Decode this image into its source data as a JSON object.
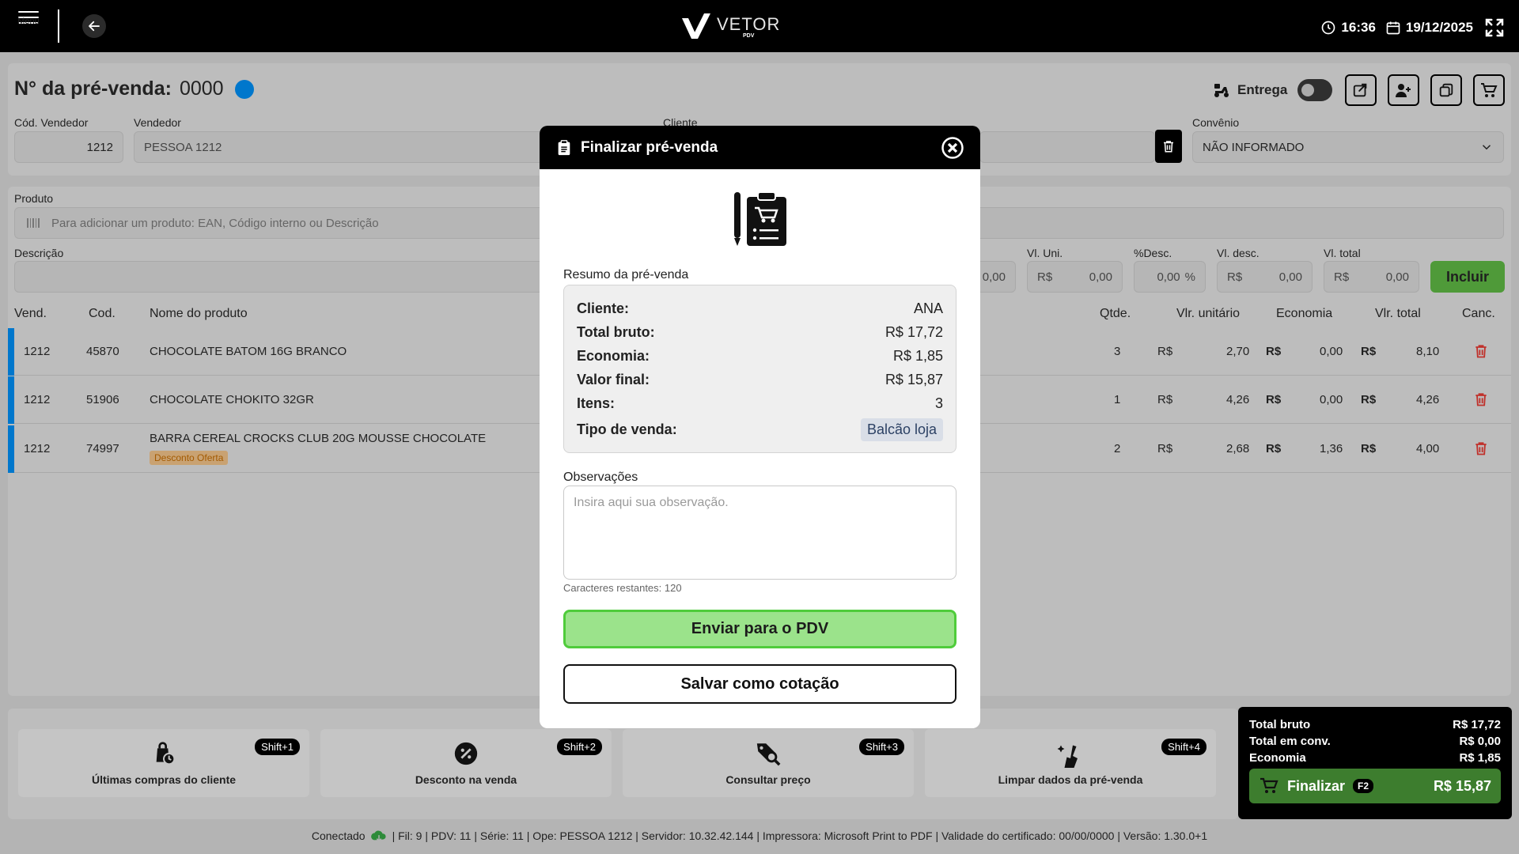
{
  "topbar": {
    "menu_label": "Menu",
    "logo_main": "VETOR",
    "logo_sub": "PDV",
    "time": "16:36",
    "date": "19/12/2025"
  },
  "header": {
    "title_prefix": "N° da pré-venda:",
    "number": "0000",
    "entrega_label": "Entrega",
    "labels": {
      "cod_vendedor": "Cód. Vendedor",
      "vendedor": "Vendedor",
      "cliente": "Cliente",
      "convenio": "Convênio"
    },
    "cod_vendedor_value": "1212",
    "vendedor_value": "PESSOA 1212",
    "convenio_value": "NÃO INFORMADO"
  },
  "product": {
    "label": "Produto",
    "placeholder": "Para adicionar um produto: EAN, Código interno ou Descrição",
    "desc_label": "Descrição",
    "qty_value": "0,00",
    "vl_uni_label": "Vl. Uni.",
    "desc_pct_label": "%Desc.",
    "vl_desc_label": "Vl. desc.",
    "vl_total_label": "Vl. total",
    "currency": "R$",
    "zero": "0,00",
    "pct": "%",
    "add_label": "Incluir"
  },
  "table": {
    "headers": {
      "vend": "Vend.",
      "cod": "Cod.",
      "nome": "Nome do produto",
      "qtde": "Qtde.",
      "unit": "Vlr. unitário",
      "economia": "Economia",
      "total": "Vlr. total",
      "canc": "Canc."
    },
    "rows": [
      {
        "vend": "1212",
        "cod": "45870",
        "nome": "CHOCOLATE BATOM 16G BRANCO",
        "badge": "",
        "qtde": "3",
        "cur": "R$",
        "unit": "2,70",
        "eco": "0,00",
        "total": "8,10"
      },
      {
        "vend": "1212",
        "cod": "51906",
        "nome": "CHOCOLATE CHOKITO 32GR",
        "badge": "",
        "qtde": "1",
        "cur": "R$",
        "unit": "4,26",
        "eco": "0,00",
        "total": "4,26"
      },
      {
        "vend": "1212",
        "cod": "74997",
        "nome": "BARRA CEREAL CROCKS CLUB 20G MOUSSE CHOCOLATE",
        "badge": "Desconto Oferta",
        "qtde": "2",
        "cur": "R$",
        "unit": "2,68",
        "eco": "1,36",
        "total": "4,00"
      }
    ]
  },
  "shortcuts": [
    {
      "label": "Últimas compras do cliente",
      "key": "Shift+1"
    },
    {
      "label": "Desconto na venda",
      "key": "Shift+2"
    },
    {
      "label": "Consultar preço",
      "key": "Shift+3"
    },
    {
      "label": "Limpar dados da pré-venda",
      "key": "Shift+4"
    }
  ],
  "totals": {
    "bruto_label": "Total bruto",
    "bruto_value": "R$ 17,72",
    "conv_label": "Total em conv.",
    "conv_value": "R$ 0,00",
    "eco_label": "Economia",
    "eco_value": "R$ 1,85",
    "finalizar_label": "Finalizar",
    "finalizar_key": "F2",
    "finalizar_value": "R$ 15,87"
  },
  "status": {
    "conectado": "Conectado",
    "details": "| Fil: 9 | PDV: 11 | Série: 11 | Ope: PESSOA 1212 | Servidor: 10.32.42.144 | Impressora: Microsoft Print to PDF | Validade do certificado: 00/00/0000 | Versão: 1.30.0+1"
  },
  "modal": {
    "title": "Finalizar pré-venda",
    "summary_label": "Resumo da pré-venda",
    "rows": [
      {
        "k": "Cliente:",
        "v": "ANA"
      },
      {
        "k": "Total bruto:",
        "v": "R$ 17,72"
      },
      {
        "k": "Economia:",
        "v": "R$ 1,85"
      },
      {
        "k": "Valor final:",
        "v": "R$ 15,87"
      },
      {
        "k": "Itens:",
        "v": "3"
      }
    ],
    "tipo_label": "Tipo de venda:",
    "tipo_value": "Balcão loja",
    "obs_label": "Observações",
    "obs_placeholder": "Insira aqui sua observação.",
    "chars_left": "Caracteres restantes: 120",
    "send_label": "Enviar para o PDV",
    "save_label": "Salvar como cotação"
  },
  "colors": {
    "accent_blue": "#0077cc",
    "green_primary": "#4fcc3b",
    "danger": "#c0312b"
  }
}
